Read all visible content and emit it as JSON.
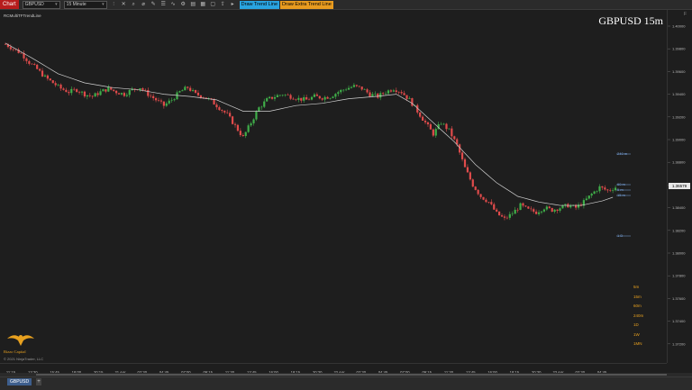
{
  "toolbar": {
    "chart_tab": "Chart",
    "instrument": "GBPUSD",
    "interval": "15 Minute",
    "tools": [
      "crosshair-icon",
      "magnet-icon",
      "bar-type-icon",
      "zoom-icon",
      "draw-icon",
      "properties-icon",
      "strategy-icon",
      "indicator-icon",
      "template-icon",
      "data-box-icon",
      "screenshot-icon",
      "share-icon",
      "more-icon"
    ],
    "draw_trend_line": "Draw Trend Line",
    "draw_extra_trend_line": "Draw Extra Trend Line"
  },
  "chart": {
    "indicator_name": "RCMultiTFTrendLine",
    "symbol_title": "GBPUSD 15m",
    "copyright": "© 2021 NinjaTrader, LLC",
    "logo_text": "Rizzo Capital",
    "price_tag": "1.36579",
    "timeframes": [
      "5m",
      "15m",
      "60m",
      "240m",
      "1D",
      "1W",
      "1MN"
    ],
    "level_tags": [
      "240 m",
      "60 m",
      "5 m",
      "15 m",
      "1 D"
    ],
    "colors": {
      "up": "#3fae49",
      "down": "#e04b4b",
      "ma": "#cfcfcf",
      "accent": "#e8a11f"
    }
  },
  "chart_data": {
    "type": "candlestick",
    "y_ticks": [
      "1.40000",
      "1.39800",
      "1.39600",
      "1.39400",
      "1.39200",
      "1.39000",
      "1.38800",
      "1.38600",
      "1.38400",
      "1.38200",
      "1.38000",
      "1.37800",
      "1.37600",
      "1.37400",
      "1.37200"
    ],
    "x_ticks": [
      "11:15",
      "13:30",
      "15:45",
      "18:00",
      "20:15",
      "21 Apr",
      "02:30",
      "04:45",
      "07:00",
      "09:15",
      "11:30",
      "13:45",
      "16:00",
      "18:15",
      "20:30",
      "22 Apr",
      "02:30",
      "04:45",
      "07:00",
      "09:15",
      "11:30",
      "13:45",
      "16:00",
      "18:15",
      "20:30",
      "23 Apr",
      "02:30",
      "04:45"
    ],
    "close_path": [
      [
        0,
        1.3984
      ],
      [
        3,
        1.398
      ],
      [
        6,
        1.3976
      ],
      [
        9,
        1.3968
      ],
      [
        12,
        1.3962
      ],
      [
        15,
        1.3955
      ],
      [
        18,
        1.395
      ],
      [
        21,
        1.3945
      ],
      [
        24,
        1.3942
      ],
      [
        27,
        1.3944
      ],
      [
        30,
        1.394
      ],
      [
        33,
        1.3938
      ],
      [
        36,
        1.3942
      ],
      [
        39,
        1.3945
      ],
      [
        42,
        1.3942
      ],
      [
        45,
        1.394
      ],
      [
        48,
        1.3944
      ],
      [
        51,
        1.3946
      ],
      [
        54,
        1.394
      ],
      [
        57,
        1.3935
      ],
      [
        60,
        1.393
      ],
      [
        63,
        1.3935
      ],
      [
        66,
        1.3942
      ],
      [
        69,
        1.3946
      ],
      [
        72,
        1.394
      ],
      [
        75,
        1.3938
      ],
      [
        78,
        1.3934
      ],
      [
        81,
        1.3928
      ],
      [
        84,
        1.3922
      ],
      [
        87,
        1.3912
      ],
      [
        90,
        1.3902
      ],
      [
        93,
        1.3915
      ],
      [
        96,
        1.3928
      ],
      [
        99,
        1.3935
      ],
      [
        102,
        1.3938
      ],
      [
        105,
        1.394
      ],
      [
        108,
        1.3938
      ],
      [
        111,
        1.3936
      ],
      [
        114,
        1.3935
      ],
      [
        117,
        1.3938
      ],
      [
        120,
        1.3937
      ],
      [
        123,
        1.3938
      ],
      [
        126,
        1.3942
      ],
      [
        129,
        1.3945
      ],
      [
        132,
        1.3947
      ],
      [
        135,
        1.3945
      ],
      [
        138,
        1.394
      ],
      [
        141,
        1.3938
      ],
      [
        144,
        1.3942
      ],
      [
        147,
        1.3945
      ],
      [
        150,
        1.3942
      ],
      [
        153,
        1.3935
      ],
      [
        156,
        1.3925
      ],
      [
        159,
        1.3915
      ],
      [
        162,
        1.3905
      ],
      [
        165,
        1.3915
      ],
      [
        168,
        1.3908
      ],
      [
        171,
        1.3895
      ],
      [
        174,
        1.3875
      ],
      [
        177,
        1.386
      ],
      [
        180,
        1.385
      ],
      [
        183,
        1.3845
      ],
      [
        186,
        1.3835
      ],
      [
        189,
        1.383
      ],
      [
        192,
        1.3835
      ],
      [
        195,
        1.3842
      ],
      [
        198,
        1.3838
      ],
      [
        201,
        1.3836
      ],
      [
        204,
        1.384
      ],
      [
        207,
        1.3838
      ],
      [
        210,
        1.384
      ],
      [
        213,
        1.3842
      ],
      [
        216,
        1.384
      ],
      [
        219,
        1.3845
      ],
      [
        222,
        1.3852
      ],
      [
        225,
        1.3858
      ],
      [
        228,
        1.3855
      ],
      [
        231,
        1.3858
      ]
    ],
    "ma_path": [
      [
        0,
        1.3985
      ],
      [
        10,
        1.3972
      ],
      [
        20,
        1.3958
      ],
      [
        30,
        1.395
      ],
      [
        40,
        1.3946
      ],
      [
        50,
        1.3944
      ],
      [
        60,
        1.394
      ],
      [
        70,
        1.3938
      ],
      [
        80,
        1.3935
      ],
      [
        90,
        1.3925
      ],
      [
        100,
        1.3925
      ],
      [
        110,
        1.393
      ],
      [
        120,
        1.3932
      ],
      [
        130,
        1.3936
      ],
      [
        140,
        1.3938
      ],
      [
        148,
        1.394
      ],
      [
        154,
        1.3932
      ],
      [
        162,
        1.3915
      ],
      [
        170,
        1.3898
      ],
      [
        178,
        1.3878
      ],
      [
        186,
        1.3862
      ],
      [
        194,
        1.385
      ],
      [
        202,
        1.3845
      ],
      [
        210,
        1.3842
      ],
      [
        218,
        1.3842
      ],
      [
        226,
        1.3846
      ],
      [
        231,
        1.385
      ]
    ]
  }
}
